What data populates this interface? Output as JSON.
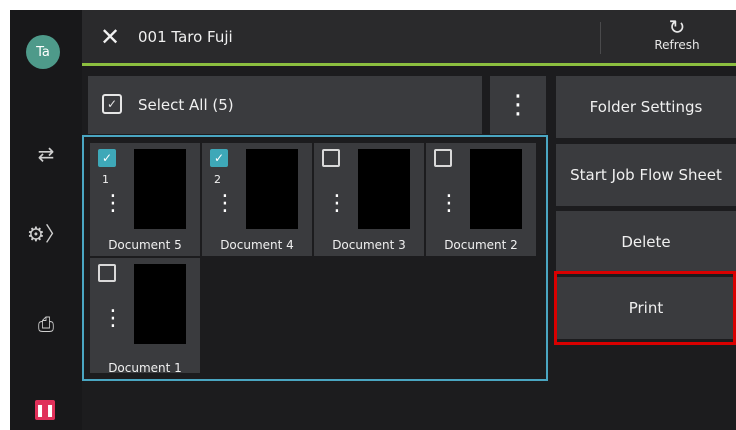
{
  "user": {
    "avatar_initials": "Ta"
  },
  "header": {
    "title": "001 Taro Fuji",
    "refresh_label": "Refresh"
  },
  "selection": {
    "select_all_label": "Select All (5)"
  },
  "actions": {
    "folder_settings": "Folder Settings",
    "start_job_flow_sheet": "Start Job Flow Sheet",
    "delete": "Delete",
    "print": "Print"
  },
  "documents": [
    {
      "name": "Document 5",
      "checked": true,
      "order": "1"
    },
    {
      "name": "Document 4",
      "checked": true,
      "order": "2"
    },
    {
      "name": "Document 3",
      "checked": false,
      "order": ""
    },
    {
      "name": "Document 2",
      "checked": false,
      "order": ""
    },
    {
      "name": "Document 1",
      "checked": false,
      "order": ""
    }
  ],
  "colors": {
    "accent_green": "#8cbf3f",
    "selection_teal": "#3ea8b8",
    "highlight_red": "#d90000",
    "pause_pink": "#e0305a"
  },
  "icons": [
    "close-icon",
    "refresh-icon",
    "select-all-icon",
    "more-vert-icon",
    "transfer-icon",
    "settings-icon",
    "printer-info-icon",
    "pause-icon"
  ]
}
